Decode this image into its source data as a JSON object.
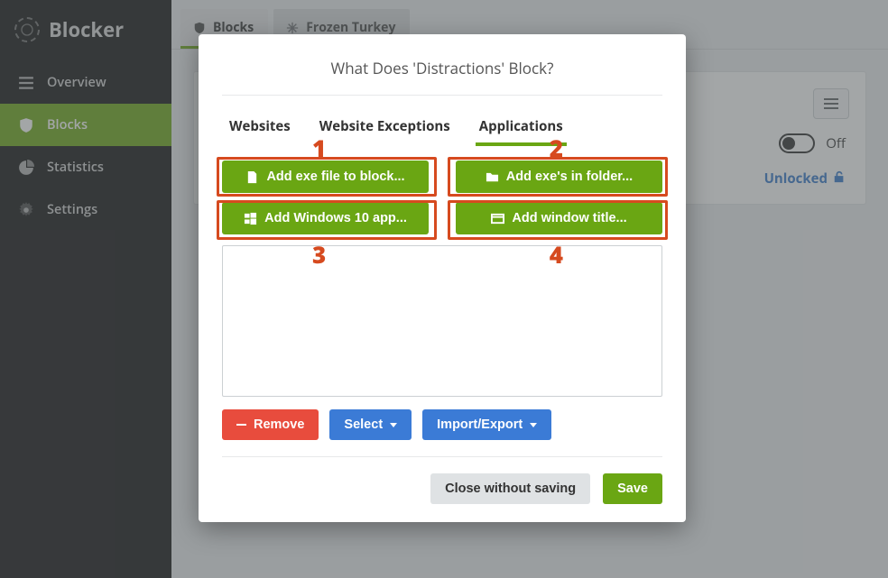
{
  "brand": "Blocker",
  "sidebar": {
    "items": [
      {
        "label": "Overview"
      },
      {
        "label": "Blocks"
      },
      {
        "label": "Statistics"
      },
      {
        "label": "Settings"
      }
    ]
  },
  "tabs": {
    "blocks": "Blocks",
    "frozen_turkey": "Frozen Turkey"
  },
  "panel": {
    "off_label": "Off",
    "unlocked_label": "Unlocked"
  },
  "modal": {
    "title": "What Does 'Distractions' Block?",
    "inner_tabs": {
      "websites": "Websites",
      "website_exceptions": "Website Exceptions",
      "applications": "Applications"
    },
    "buttons": {
      "add_exe": "Add exe file to block...",
      "add_folder": "Add exe's in folder...",
      "add_win10": "Add Windows 10 app...",
      "add_window_title": "Add window title..."
    },
    "annotations": [
      "1",
      "2",
      "3",
      "4"
    ],
    "actions": {
      "remove": "Remove",
      "select": "Select",
      "import_export": "Import/Export"
    },
    "footer": {
      "close": "Close without saving",
      "save": "Save"
    }
  }
}
